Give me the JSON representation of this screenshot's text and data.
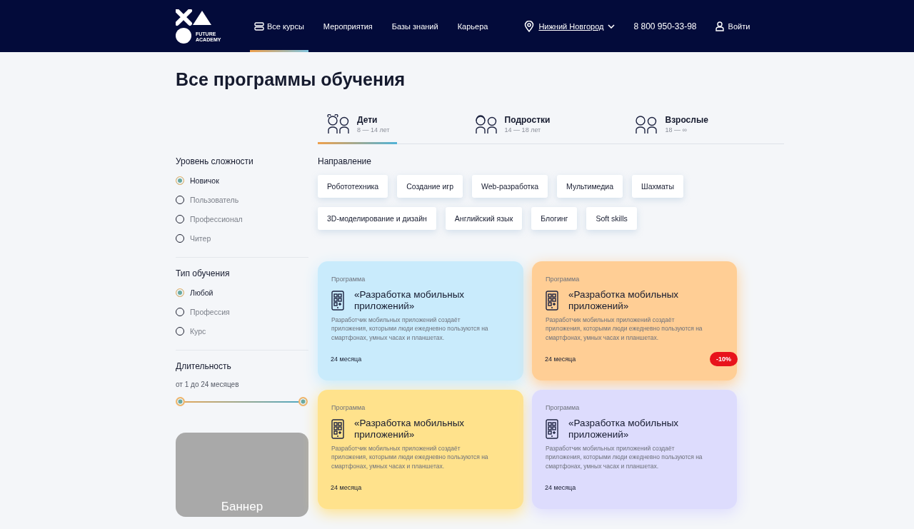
{
  "header": {
    "logo_text": "FUTURE ACADEMY",
    "nav": [
      {
        "label": "Все курсы",
        "selected": true,
        "kind": "menu"
      },
      {
        "label": "Мероприятия",
        "selected": false,
        "kind": "link"
      },
      {
        "label": "Базы знаний",
        "selected": false,
        "kind": "link"
      },
      {
        "label": "Карьера",
        "selected": false,
        "kind": "link"
      }
    ],
    "city": "Нижний Новгород",
    "phone": "8 800 950-33-98",
    "login": "Войти"
  },
  "page_title": "Все программы обучения",
  "age_tabs": [
    {
      "label": "Дети",
      "range": "8 — 14 лет",
      "selected": true
    },
    {
      "label": "Подростки",
      "range": "14 — 18 лет",
      "selected": false
    },
    {
      "label": "Взрослые",
      "range": "18 — ∞",
      "selected": false
    }
  ],
  "filters": [
    {
      "title": "Уровень сложности",
      "options": [
        {
          "label": "Новичок",
          "selected": true
        },
        {
          "label": "Пользователь",
          "selected": false
        },
        {
          "label": "Профессионал",
          "selected": false
        },
        {
          "label": "Читер",
          "selected": false
        }
      ]
    },
    {
      "title": "Тип обучения",
      "options": [
        {
          "label": "Любой",
          "selected": true
        },
        {
          "label": "Профессия",
          "selected": false
        },
        {
          "label": "Курс",
          "selected": false
        }
      ]
    }
  ],
  "duration": {
    "title": "Длительность",
    "range_text": "от 1 до 24 месяцев",
    "level": 1
  },
  "banner": {
    "text": "Баннер"
  },
  "directions": {
    "title": "Направление",
    "chips": [
      "Робототехника",
      "Создание игр",
      "Web-разработка",
      "Мультимедиа",
      "Шахматы",
      "3D-моделирование и дизайн",
      "Английский язык",
      "Блогинг",
      "Soft skills"
    ]
  },
  "cards": [
    {
      "type": "Программа",
      "title": "«Разработка мобильных приложений»",
      "description": "Разработчик мобильных приложений создаёт приложения, которыми люди ежедневно пользуются на смартфонах, умных часах и планшетах.",
      "duration": "24 месяца",
      "color": "#c9ebfc"
    },
    {
      "type": "Программа",
      "title": "«Разработка мобильных приложений»",
      "description": "Разработчик мобильных приложений создаёт приложения, которыми люди ежедневно пользуются на смартфонах, умных часах и планшетах.",
      "duration": "24 месяца",
      "color": "#ffce95",
      "discount": "-10%"
    },
    {
      "type": "Программа",
      "title": "«Разработка мобильных приложений»",
      "description": "Разработчик мобильных приложений создаёт приложения, которыми люди ежедневно пользуются на смартфонах, умных часах и планшетах.",
      "duration": "24 месяца",
      "color": "#ffe28c"
    },
    {
      "type": "Программа",
      "title": "«Разработка мобильных приложений»",
      "description": "Разработчик мобильных приложений создаёт приложения, которыми люди ежедневно пользуются на смартфонах, умных часах и планшетах.",
      "duration": "24 месяца",
      "color": "#dddcfd"
    }
  ]
}
